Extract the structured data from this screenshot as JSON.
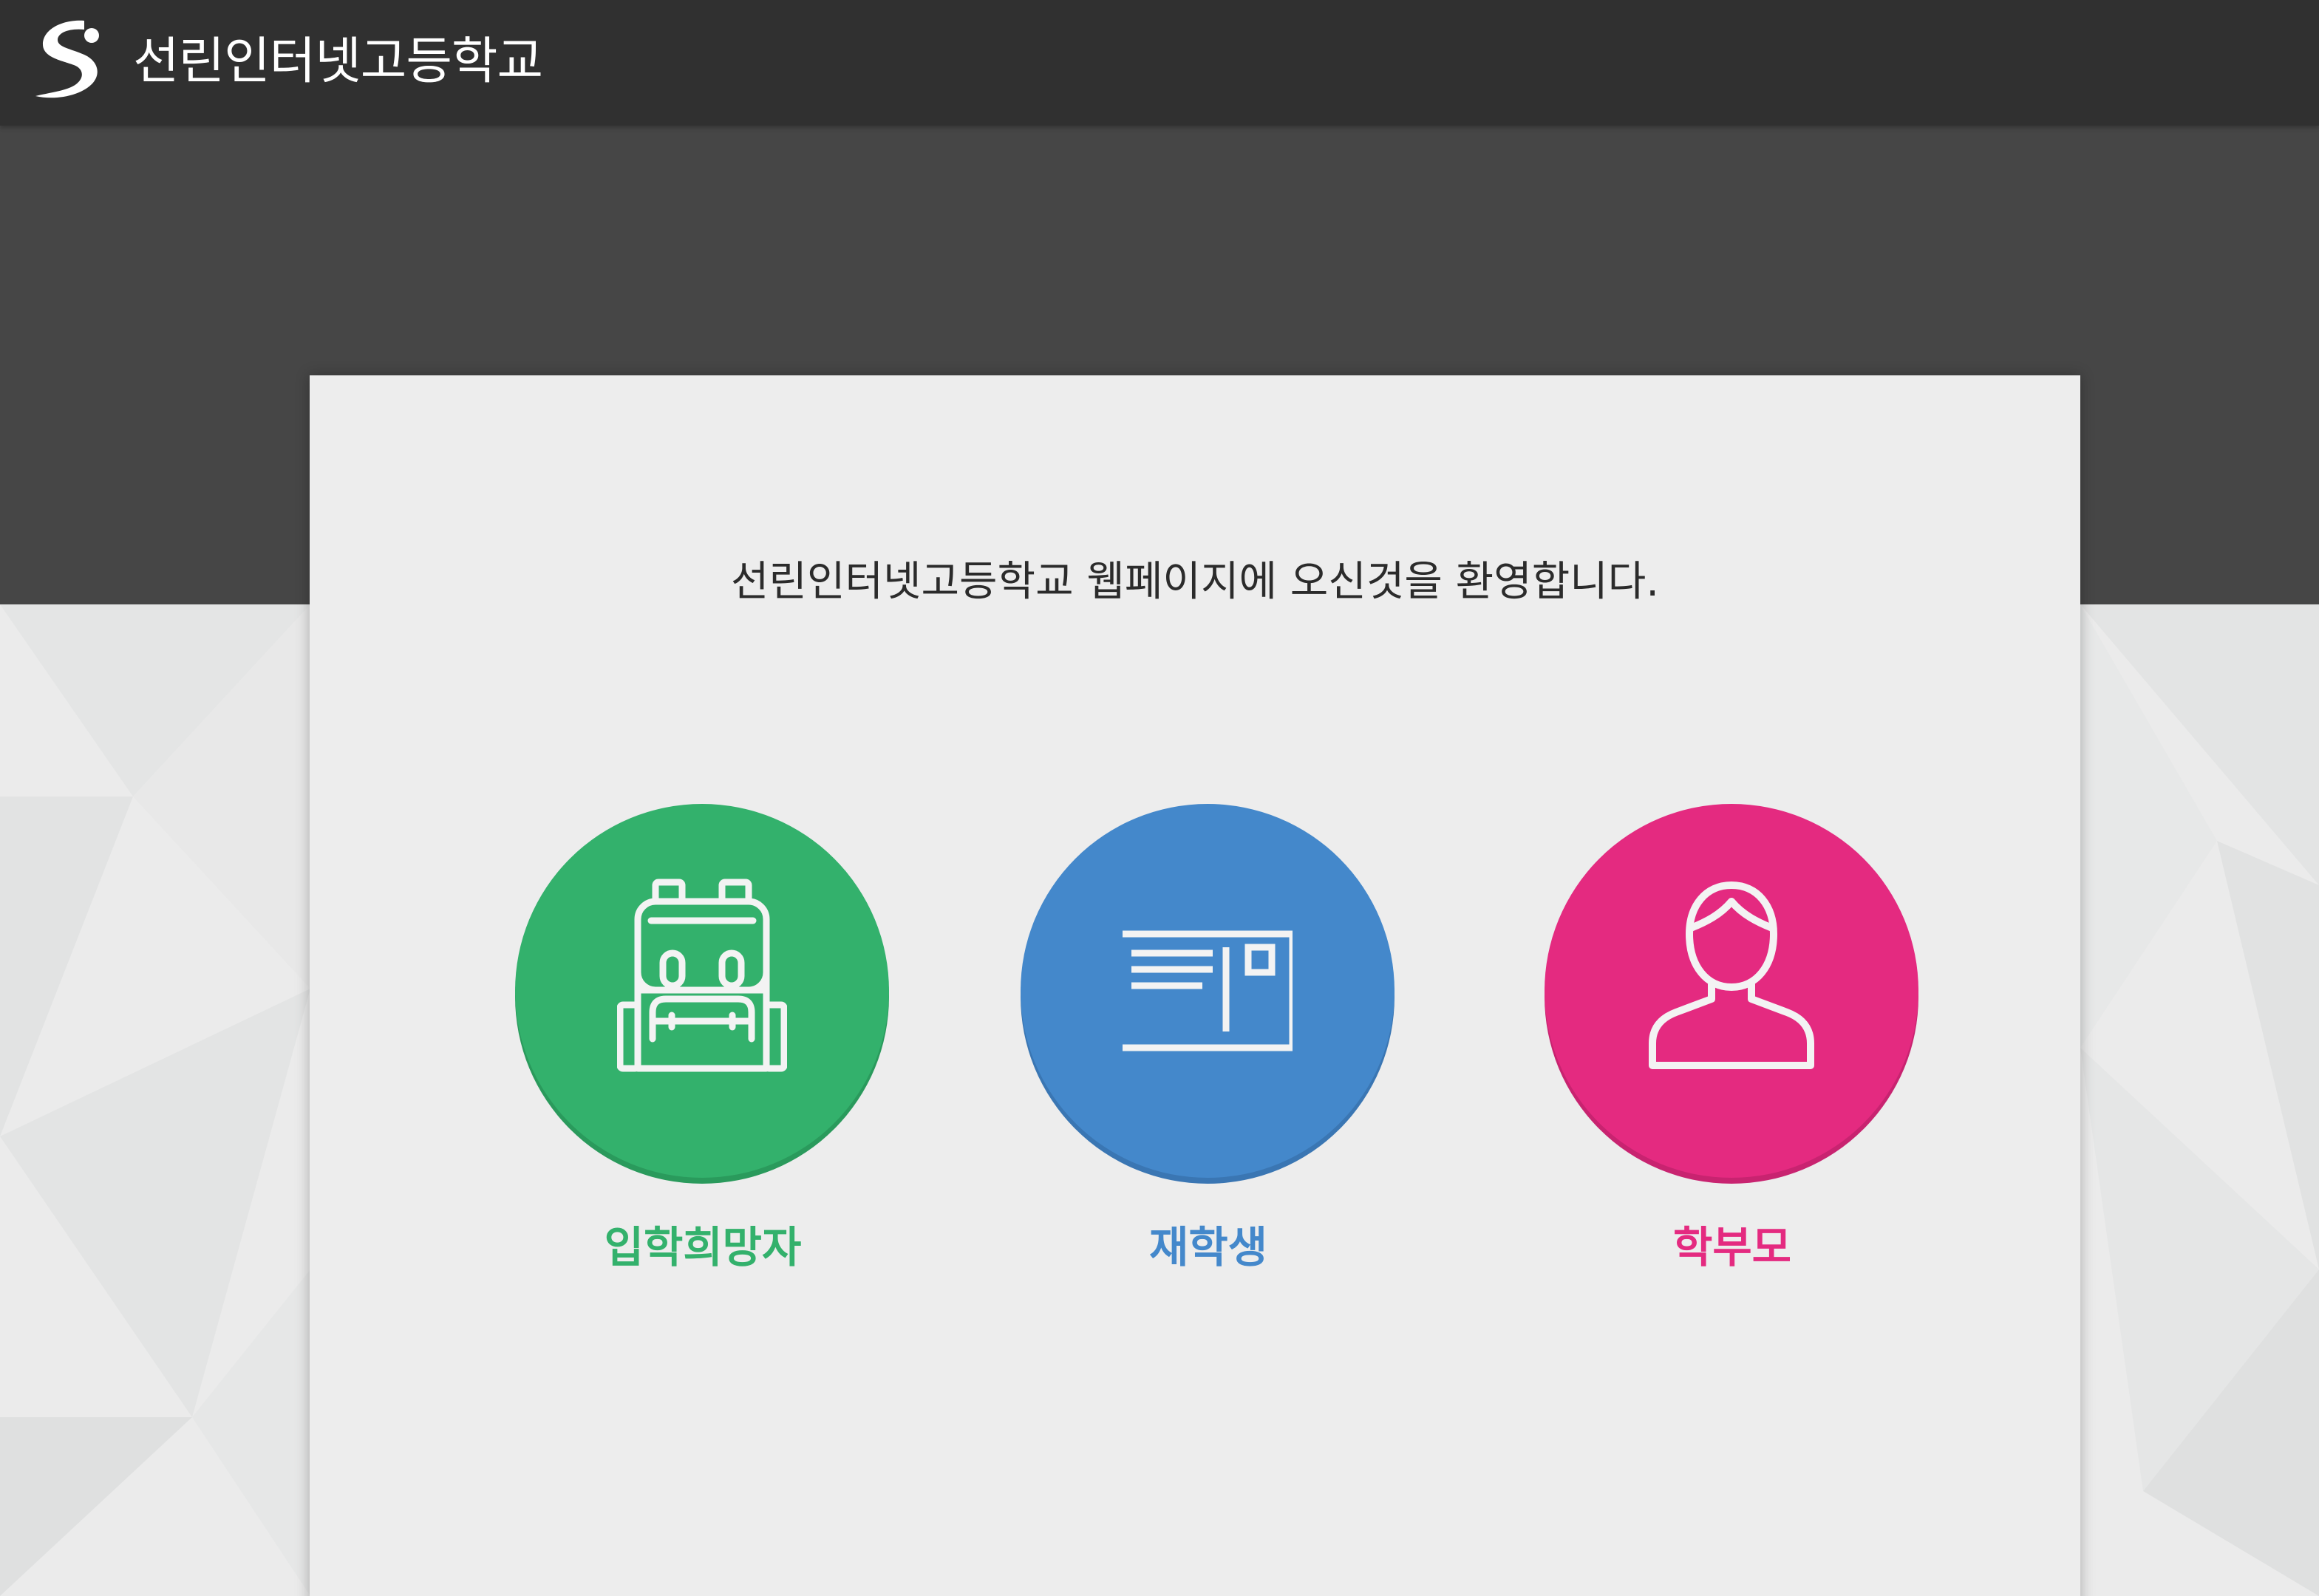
{
  "header": {
    "logo_name": "sunrin-logo",
    "title": "선린인터넷고등학교"
  },
  "main": {
    "welcome_text": "선린인터넷고등학교 웹페이지에 오신것을 환영합니다.",
    "choices": [
      {
        "label": "입학희망자",
        "icon": "backpack-icon",
        "color": "#33b16c",
        "shade": "#2a9a5c"
      },
      {
        "label": "재학생",
        "icon": "id-card-icon",
        "color": "#4488cb",
        "shade": "#3a76b3"
      },
      {
        "label": "학부모",
        "icon": "person-icon",
        "color": "#e42a80",
        "shade": "#c82370"
      }
    ]
  },
  "colors": {
    "topbar": "#303030",
    "hero": "#464646",
    "background": "#ebebeb",
    "card": "#ededed"
  }
}
